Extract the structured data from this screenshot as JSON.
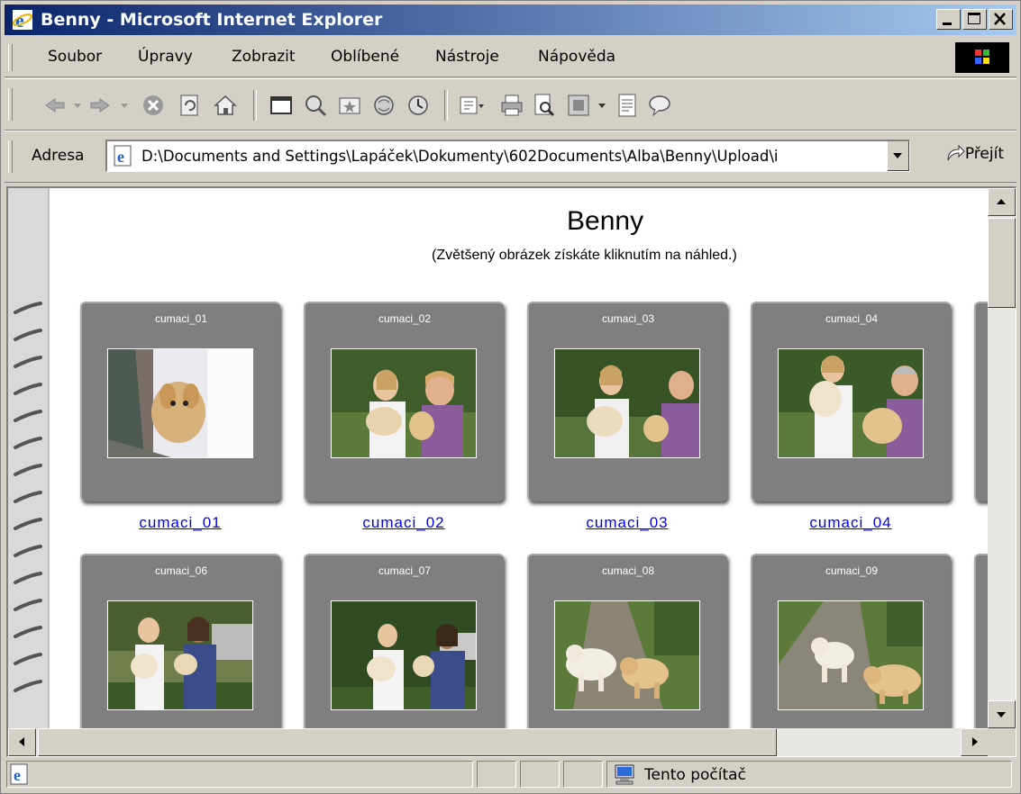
{
  "window": {
    "title": "Benny - Microsoft Internet Explorer"
  },
  "menu": {
    "items": [
      "Soubor",
      "Úpravy",
      "Zobrazit",
      "Oblíbené",
      "Nástroje",
      "Nápověda"
    ]
  },
  "toolbar": {
    "icons": [
      "back-icon",
      "forward-icon",
      "stop-icon",
      "refresh-icon",
      "home-icon",
      "fullscreen-icon",
      "search-icon",
      "favorites-icon",
      "media-icon",
      "history-icon",
      "mail-icon",
      "print-icon",
      "print-preview-icon",
      "edit-icon",
      "discuss-icon",
      "messenger-icon"
    ]
  },
  "address": {
    "label": "Adresa",
    "value": "D:\\Documents and Settings\\Lapáček\\Dokumenty\\602Documents\\Alba\\Benny\\Upload\\i",
    "go_label": "Přejít"
  },
  "page": {
    "title": "Benny",
    "subtitle": "(Zvětšený obrázek získáte kliknutím na náhled.)",
    "gallery": [
      {
        "label": "cumaci_01",
        "caption": "cumaci_01",
        "photo": "puppy-in-corner"
      },
      {
        "label": "cumaci_02",
        "caption": "cumaci_02",
        "photo": "two-women-with-puppies"
      },
      {
        "label": "cumaci_03",
        "caption": "cumaci_03",
        "photo": "two-women-with-puppies"
      },
      {
        "label": "cumaci_04",
        "caption": "cumaci_04",
        "photo": "two-women-with-puppies"
      },
      {
        "label": "cumaci_06",
        "caption": "",
        "photo": "couple-with-puppies"
      },
      {
        "label": "cumaci_07",
        "caption": "",
        "photo": "couple-with-puppies"
      },
      {
        "label": "cumaci_08",
        "caption": "",
        "photo": "puppies-on-path"
      },
      {
        "label": "cumaci_09",
        "caption": "",
        "photo": "puppies-on-path"
      }
    ]
  },
  "status": {
    "zone": "Tento počítač"
  },
  "colors": {
    "title_bar": "#0a246a",
    "link": "#0000ee",
    "slide_frame": "#7f7f7f"
  }
}
